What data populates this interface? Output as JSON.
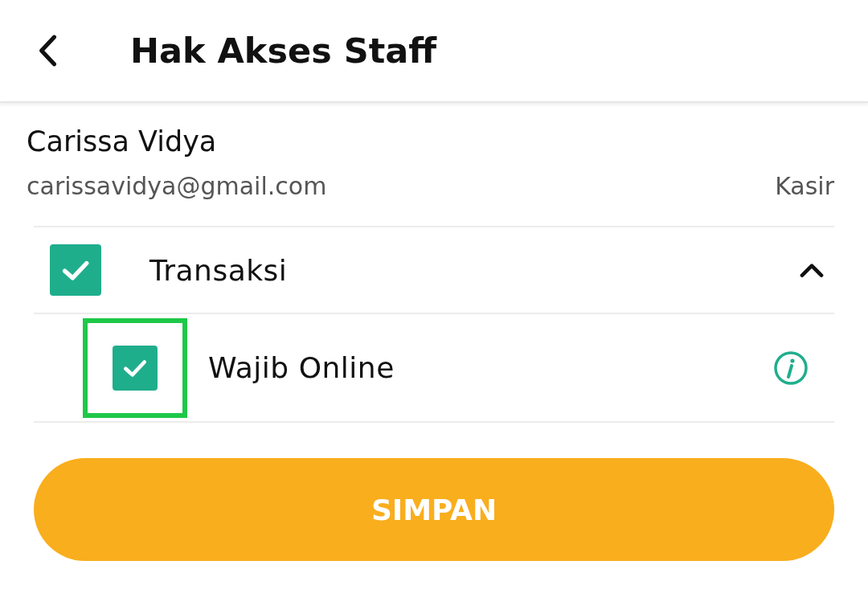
{
  "header": {
    "title": "Hak Akses Staff"
  },
  "staff": {
    "name": "Carissa Vidya",
    "email": "carissavidya@gmail.com",
    "role": "Kasir"
  },
  "permissions": [
    {
      "label": "Transaksi",
      "checked": true,
      "expanded": true,
      "children": [
        {
          "label": "Wajib Online",
          "checked": true,
          "highlighted": true
        }
      ]
    }
  ],
  "save_button": {
    "label": "SIMPAN"
  }
}
